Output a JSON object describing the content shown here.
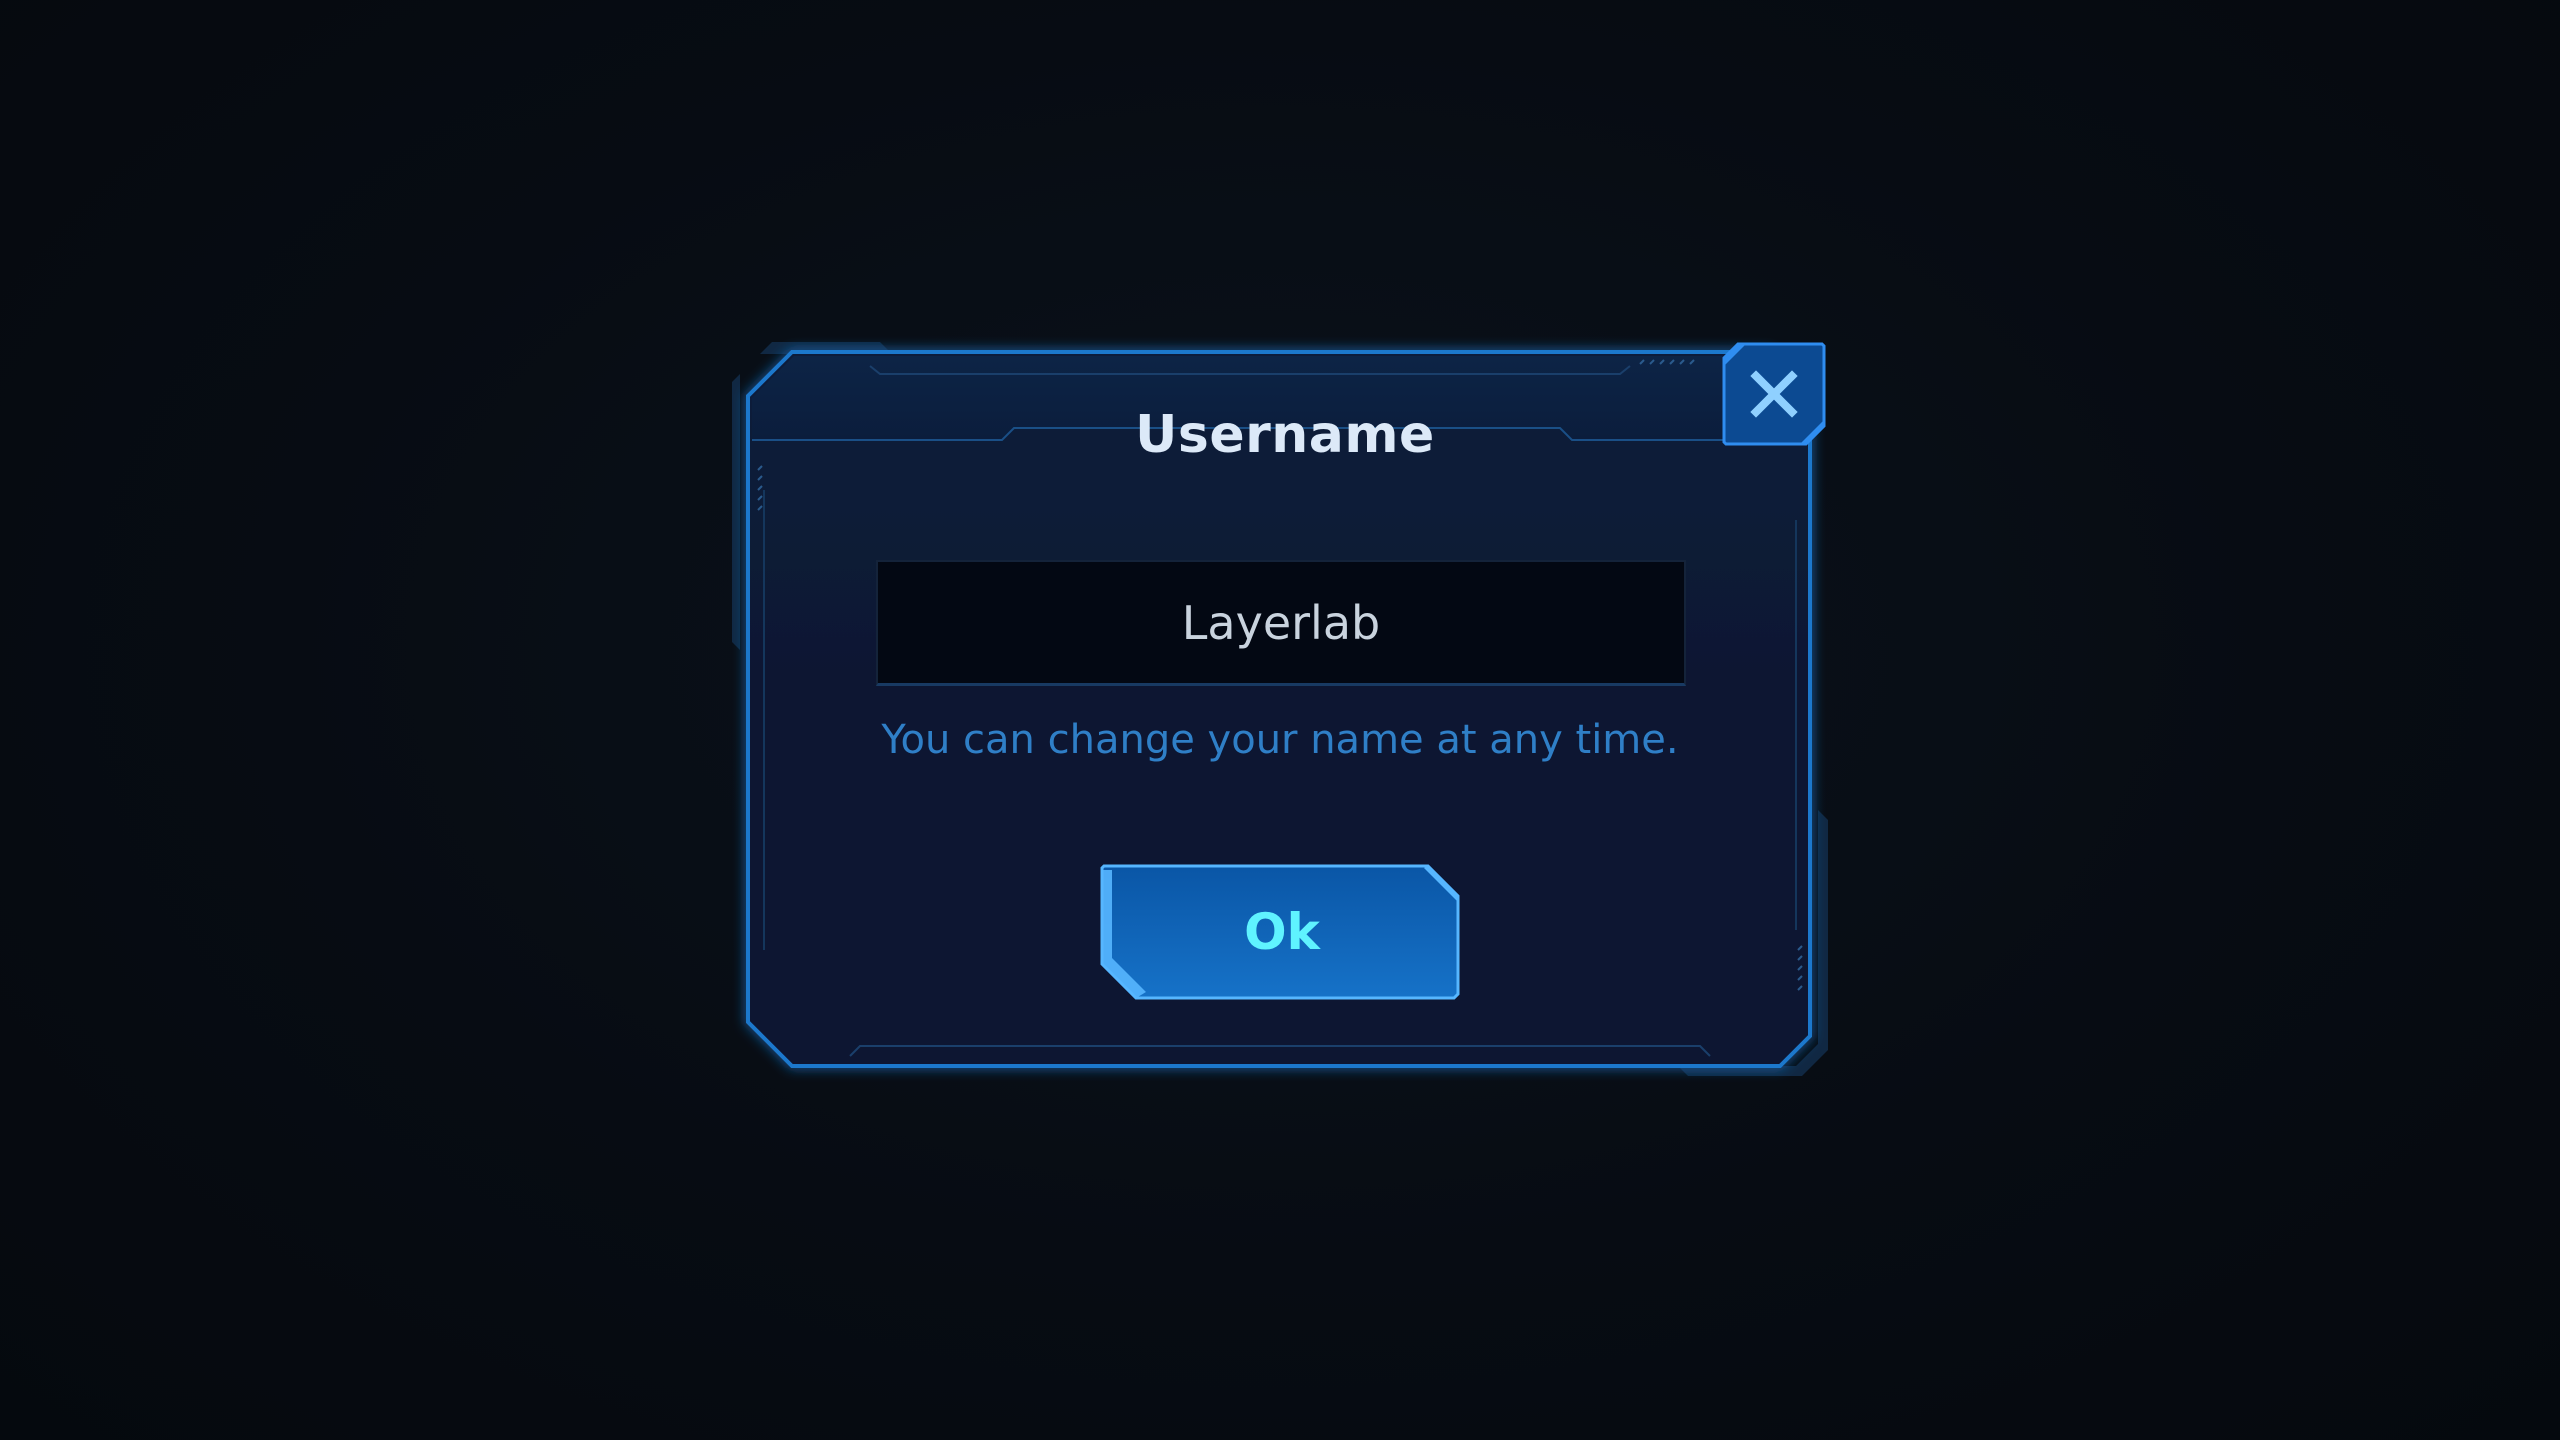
{
  "dialog": {
    "title": "Username",
    "input": {
      "value": "Layerlab",
      "placeholder": ""
    },
    "hint": "You can change your name at any time.",
    "ok_label": "Ok",
    "close_icon": "close-icon"
  },
  "colors": {
    "background": "#070c13",
    "panel": "#0a1a33",
    "border": "#1d6fc0",
    "hint_text": "#2f7fc7",
    "ok_text": "#5ff3ff",
    "button_fill": "#1260b0"
  }
}
